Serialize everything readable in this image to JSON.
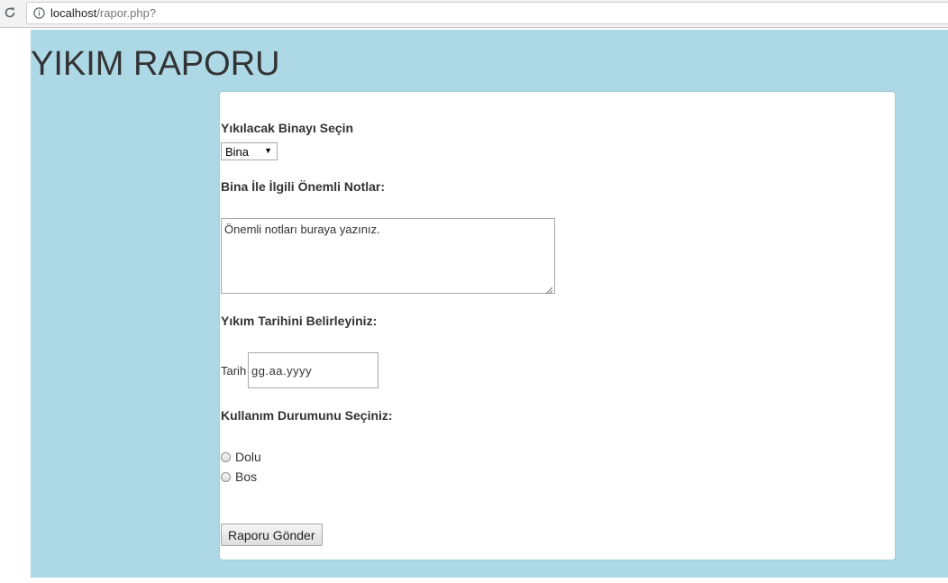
{
  "browser": {
    "url_host": "localhost",
    "url_path": "/rapor.php?"
  },
  "page": {
    "title": "YIKIM RAPORU",
    "background_color": "#add8e6"
  },
  "form": {
    "building_label": "Yıkılacak Binayı Seçin",
    "building_select_value": "Bina",
    "notes_label": "Bina İle İlgili Önemli Notlar:",
    "notes_value": "Önemli notları buraya yazınız.",
    "date_section_label": "Yıkım Tarihini Belirleyiniz:",
    "date_prefix": "Tarih",
    "date_placeholder": "gg.aa.yyyy",
    "usage_label": "Kullanım Durumunu Seçiniz:",
    "usage_options": [
      {
        "label": "Dolu",
        "checked": false
      },
      {
        "label": "Bos",
        "checked": false
      }
    ],
    "submit_label": "Raporu Gönder"
  }
}
